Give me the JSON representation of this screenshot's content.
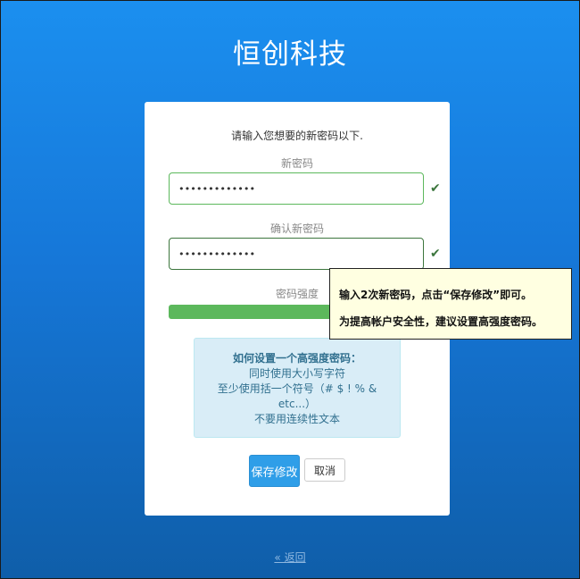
{
  "brand": {
    "title": "恒创科技"
  },
  "form": {
    "instruction": "请输入您想要的新密码以下.",
    "new_password": {
      "label": "新密码",
      "value": "•••••••••••••"
    },
    "confirm_password": {
      "label": "确认新密码",
      "value": "•••••••••••••"
    },
    "strength": {
      "label": "密码强度",
      "level": 1.0,
      "color": "#5cb85c"
    },
    "tips": {
      "title": "如何设置一个高强度密码：",
      "line1": "同时使用大小写字符",
      "line2": "至少使用括一个符号（# $ ! % &",
      "line3": "etc...）",
      "line4": "不要用连续性文本"
    },
    "save_label": "保存修改",
    "cancel_label": "取消"
  },
  "footer": {
    "back_label": "« 返回"
  },
  "tooltip": {
    "line1": "输入2次新密码，点击“保存修改”即可。",
    "line2": "为提高帐户安全性，建议设置高强度密码。"
  },
  "icons": {
    "valid": "check-icon"
  },
  "colors": {
    "accent": "#2f9ee8",
    "success": "#5cb85c",
    "background": "#1677d8"
  }
}
